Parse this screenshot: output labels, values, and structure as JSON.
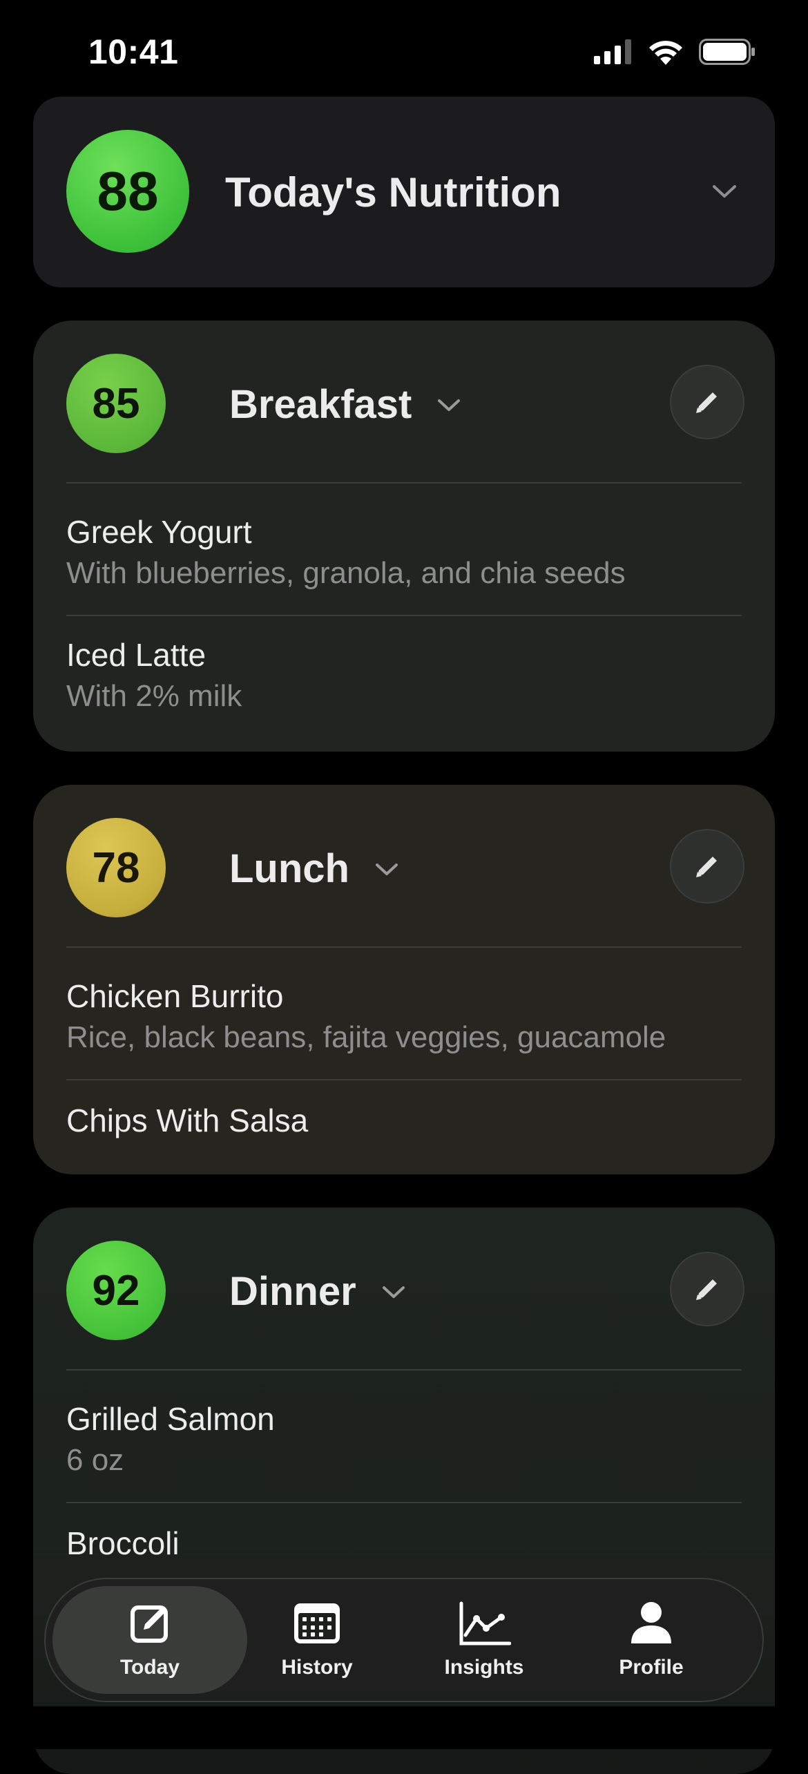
{
  "status_bar": {
    "time": "10:41"
  },
  "summary": {
    "score": "88",
    "title": "Today's Nutrition",
    "score_color": "#46c23a"
  },
  "meals": [
    {
      "name": "Breakfast",
      "score": "85",
      "score_color": "#5cb83a",
      "items": [
        {
          "name": "Greek Yogurt",
          "desc": "With blueberries, granola, and chia seeds"
        },
        {
          "name": "Iced Latte",
          "desc": "With 2% milk"
        }
      ]
    },
    {
      "name": "Lunch",
      "score": "78",
      "score_color": "#c6ae3c",
      "items": [
        {
          "name": "Chicken Burrito",
          "desc": "Rice, black beans, fajita veggies, guacamole"
        },
        {
          "name": "Chips With Salsa",
          "desc": ""
        }
      ]
    },
    {
      "name": "Dinner",
      "score": "92",
      "score_color": "#46c23a",
      "items": [
        {
          "name": "Grilled Salmon",
          "desc": "6 oz"
        },
        {
          "name": "Broccoli",
          "desc": ""
        }
      ]
    }
  ],
  "tabs": [
    {
      "label": "Today",
      "icon": "edit-square-icon",
      "active": true
    },
    {
      "label": "History",
      "icon": "calendar-icon",
      "active": false
    },
    {
      "label": "Insights",
      "icon": "line-chart-icon",
      "active": false
    },
    {
      "label": "Profile",
      "icon": "person-icon",
      "active": false
    }
  ]
}
